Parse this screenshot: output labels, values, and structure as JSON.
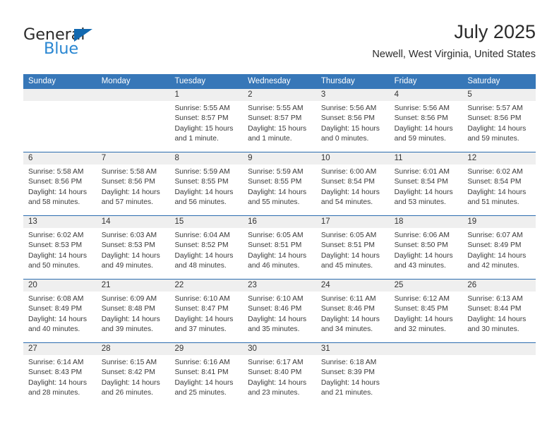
{
  "logo": {
    "word1": "General",
    "word2": "Blue",
    "triangle_color": "#1269b0",
    "word2_color": "#2a87d2"
  },
  "header": {
    "title": "July 2025",
    "subtitle": "Newell, West Virginia, United States"
  },
  "theme": {
    "header_blue": "#3777b8",
    "row_divider_blue": "#2c6daf",
    "day_band_gray": "#efefef"
  },
  "weekdays": [
    "Sunday",
    "Monday",
    "Tuesday",
    "Wednesday",
    "Thursday",
    "Friday",
    "Saturday"
  ],
  "weeks": [
    [
      {
        "day": "",
        "lines": []
      },
      {
        "day": "",
        "lines": []
      },
      {
        "day": "1",
        "lines": [
          "Sunrise: 5:55 AM",
          "Sunset: 8:57 PM",
          "Daylight: 15 hours",
          "and 1 minute."
        ]
      },
      {
        "day": "2",
        "lines": [
          "Sunrise: 5:55 AM",
          "Sunset: 8:57 PM",
          "Daylight: 15 hours",
          "and 1 minute."
        ]
      },
      {
        "day": "3",
        "lines": [
          "Sunrise: 5:56 AM",
          "Sunset: 8:56 PM",
          "Daylight: 15 hours",
          "and 0 minutes."
        ]
      },
      {
        "day": "4",
        "lines": [
          "Sunrise: 5:56 AM",
          "Sunset: 8:56 PM",
          "Daylight: 14 hours",
          "and 59 minutes."
        ]
      },
      {
        "day": "5",
        "lines": [
          "Sunrise: 5:57 AM",
          "Sunset: 8:56 PM",
          "Daylight: 14 hours",
          "and 59 minutes."
        ]
      }
    ],
    [
      {
        "day": "6",
        "lines": [
          "Sunrise: 5:58 AM",
          "Sunset: 8:56 PM",
          "Daylight: 14 hours",
          "and 58 minutes."
        ]
      },
      {
        "day": "7",
        "lines": [
          "Sunrise: 5:58 AM",
          "Sunset: 8:56 PM",
          "Daylight: 14 hours",
          "and 57 minutes."
        ]
      },
      {
        "day": "8",
        "lines": [
          "Sunrise: 5:59 AM",
          "Sunset: 8:55 PM",
          "Daylight: 14 hours",
          "and 56 minutes."
        ]
      },
      {
        "day": "9",
        "lines": [
          "Sunrise: 5:59 AM",
          "Sunset: 8:55 PM",
          "Daylight: 14 hours",
          "and 55 minutes."
        ]
      },
      {
        "day": "10",
        "lines": [
          "Sunrise: 6:00 AM",
          "Sunset: 8:54 PM",
          "Daylight: 14 hours",
          "and 54 minutes."
        ]
      },
      {
        "day": "11",
        "lines": [
          "Sunrise: 6:01 AM",
          "Sunset: 8:54 PM",
          "Daylight: 14 hours",
          "and 53 minutes."
        ]
      },
      {
        "day": "12",
        "lines": [
          "Sunrise: 6:02 AM",
          "Sunset: 8:54 PM",
          "Daylight: 14 hours",
          "and 51 minutes."
        ]
      }
    ],
    [
      {
        "day": "13",
        "lines": [
          "Sunrise: 6:02 AM",
          "Sunset: 8:53 PM",
          "Daylight: 14 hours",
          "and 50 minutes."
        ]
      },
      {
        "day": "14",
        "lines": [
          "Sunrise: 6:03 AM",
          "Sunset: 8:53 PM",
          "Daylight: 14 hours",
          "and 49 minutes."
        ]
      },
      {
        "day": "15",
        "lines": [
          "Sunrise: 6:04 AM",
          "Sunset: 8:52 PM",
          "Daylight: 14 hours",
          "and 48 minutes."
        ]
      },
      {
        "day": "16",
        "lines": [
          "Sunrise: 6:05 AM",
          "Sunset: 8:51 PM",
          "Daylight: 14 hours",
          "and 46 minutes."
        ]
      },
      {
        "day": "17",
        "lines": [
          "Sunrise: 6:05 AM",
          "Sunset: 8:51 PM",
          "Daylight: 14 hours",
          "and 45 minutes."
        ]
      },
      {
        "day": "18",
        "lines": [
          "Sunrise: 6:06 AM",
          "Sunset: 8:50 PM",
          "Daylight: 14 hours",
          "and 43 minutes."
        ]
      },
      {
        "day": "19",
        "lines": [
          "Sunrise: 6:07 AM",
          "Sunset: 8:49 PM",
          "Daylight: 14 hours",
          "and 42 minutes."
        ]
      }
    ],
    [
      {
        "day": "20",
        "lines": [
          "Sunrise: 6:08 AM",
          "Sunset: 8:49 PM",
          "Daylight: 14 hours",
          "and 40 minutes."
        ]
      },
      {
        "day": "21",
        "lines": [
          "Sunrise: 6:09 AM",
          "Sunset: 8:48 PM",
          "Daylight: 14 hours",
          "and 39 minutes."
        ]
      },
      {
        "day": "22",
        "lines": [
          "Sunrise: 6:10 AM",
          "Sunset: 8:47 PM",
          "Daylight: 14 hours",
          "and 37 minutes."
        ]
      },
      {
        "day": "23",
        "lines": [
          "Sunrise: 6:10 AM",
          "Sunset: 8:46 PM",
          "Daylight: 14 hours",
          "and 35 minutes."
        ]
      },
      {
        "day": "24",
        "lines": [
          "Sunrise: 6:11 AM",
          "Sunset: 8:46 PM",
          "Daylight: 14 hours",
          "and 34 minutes."
        ]
      },
      {
        "day": "25",
        "lines": [
          "Sunrise: 6:12 AM",
          "Sunset: 8:45 PM",
          "Daylight: 14 hours",
          "and 32 minutes."
        ]
      },
      {
        "day": "26",
        "lines": [
          "Sunrise: 6:13 AM",
          "Sunset: 8:44 PM",
          "Daylight: 14 hours",
          "and 30 minutes."
        ]
      }
    ],
    [
      {
        "day": "27",
        "lines": [
          "Sunrise: 6:14 AM",
          "Sunset: 8:43 PM",
          "Daylight: 14 hours",
          "and 28 minutes."
        ]
      },
      {
        "day": "28",
        "lines": [
          "Sunrise: 6:15 AM",
          "Sunset: 8:42 PM",
          "Daylight: 14 hours",
          "and 26 minutes."
        ]
      },
      {
        "day": "29",
        "lines": [
          "Sunrise: 6:16 AM",
          "Sunset: 8:41 PM",
          "Daylight: 14 hours",
          "and 25 minutes."
        ]
      },
      {
        "day": "30",
        "lines": [
          "Sunrise: 6:17 AM",
          "Sunset: 8:40 PM",
          "Daylight: 14 hours",
          "and 23 minutes."
        ]
      },
      {
        "day": "31",
        "lines": [
          "Sunrise: 6:18 AM",
          "Sunset: 8:39 PM",
          "Daylight: 14 hours",
          "and 21 minutes."
        ]
      },
      {
        "day": "",
        "lines": []
      },
      {
        "day": "",
        "lines": []
      }
    ]
  ]
}
